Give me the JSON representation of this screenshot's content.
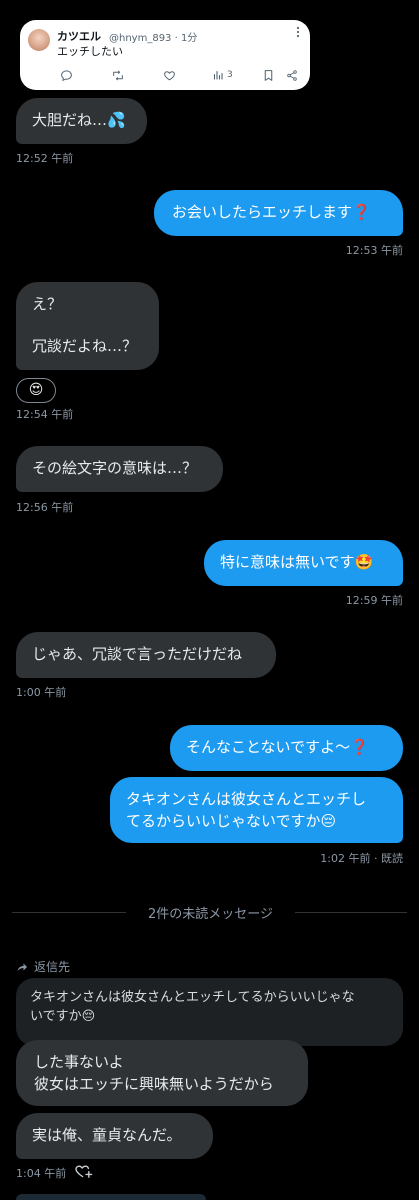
{
  "quoted_tweet": {
    "name": "カツエル",
    "handle": "@hnym_893 · 1分",
    "text": "エッチしたい",
    "views": "3",
    "more_icon": "more-vertical-icon",
    "reply_icon": "reply-icon",
    "retweet_icon": "retweet-icon",
    "like_icon": "like-icon",
    "views_icon": "views-icon",
    "bookmark_icon": "bookmark-icon",
    "share_icon": "share-icon"
  },
  "messages": [
    {
      "side": "in",
      "text": "大胆だね…💦",
      "time": "12:52 午前"
    },
    {
      "side": "out",
      "text": "お会いしたらエッチします❓",
      "time": "12:53 午前"
    },
    {
      "side": "in",
      "lines": [
        "え？",
        "",
        "冗談だよね…？"
      ],
      "reaction": "😍",
      "time": "12:54 午前"
    },
    {
      "side": "in",
      "text": "その絵文字の意味は…？",
      "time": "12:56 午前"
    },
    {
      "side": "out",
      "text": "特に意味は無いです🤩",
      "time": "12:59 午前"
    },
    {
      "side": "in",
      "text": "じゃあ、冗談で言っただけだね",
      "time": "1:00 午前"
    },
    {
      "side": "out",
      "text": "そんなことないですよ〜❓"
    },
    {
      "side": "out",
      "lines": [
        "タキオンさんは彼女さんとエッチし",
        "てるからいいじゃないですか😔"
      ],
      "time": "1:02 午前 · 既読"
    }
  ],
  "unread_divider": "2件の未読メッセージ",
  "reply": {
    "label": "返信先",
    "quoted_lines": [
      "タキオンさんは彼女さんとエッチしてるからいいじゃな",
      "いですか😔"
    ],
    "icon": "reply-arrow-icon"
  },
  "received": [
    {
      "lines": [
        "した事ないよ",
        "彼女はエッチに興味無いようだから"
      ]
    },
    {
      "text": "実は俺、童貞なんだ。",
      "time": "1:04 午前"
    }
  ],
  "add_reaction_icon": "add-reaction-icon",
  "colors": {
    "background": "#000000",
    "incoming_bubble": "#2f3336",
    "outgoing_bubble": "#1d9bf0",
    "timestamp": "#8b98a5"
  }
}
